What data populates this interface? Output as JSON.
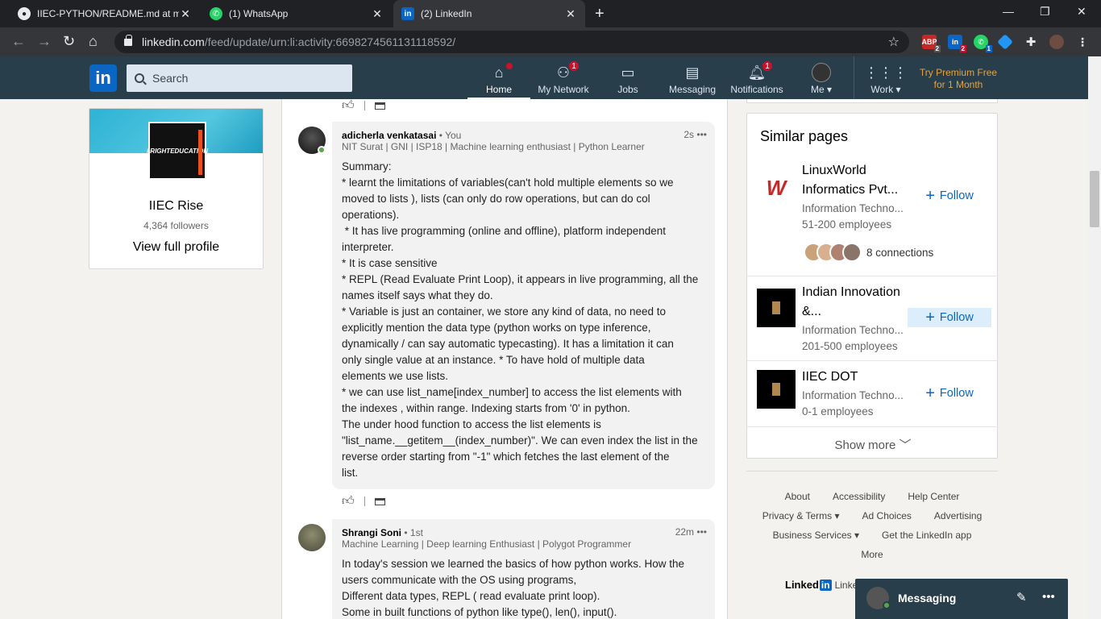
{
  "browser": {
    "tabs": [
      {
        "title": "IIEC-PYTHON/README.md at ma",
        "icon": "github-icon"
      },
      {
        "title": "(1) WhatsApp",
        "icon": "whatsapp-icon"
      },
      {
        "title": "(2) LinkedIn",
        "icon": "linkedin-icon"
      }
    ],
    "url_host": "linkedin.com",
    "url_path": "/feed/update/urn:li:activity:6698274561131118592/",
    "extensions": [
      {
        "name": "adblock-extension-icon",
        "badge": "2"
      },
      {
        "name": "linkedin-extension-icon",
        "badge": "2"
      },
      {
        "name": "whatsapp-extension-icon",
        "badge": "1"
      }
    ]
  },
  "header": {
    "logo": "in",
    "search_placeholder": "Search",
    "nav": [
      {
        "label": "Home",
        "badge": ""
      },
      {
        "label": "My Network",
        "badge": "1"
      },
      {
        "label": "Jobs",
        "badge": ""
      },
      {
        "label": "Messaging",
        "badge": ""
      },
      {
        "label": "Notifications",
        "badge": "1"
      },
      {
        "label": "Me",
        "badge": ""
      },
      {
        "label": "Work",
        "badge": ""
      }
    ],
    "premium_line1": "Try Premium Free",
    "premium_line2": "for 1 Month"
  },
  "profile": {
    "logo_text": "#RIGHTEDUCATION",
    "name": "IIEC Rise",
    "followers": "4,364 followers",
    "view_full_profile": "View full profile"
  },
  "comments": [
    {
      "name": "adicherla venkatasai",
      "degree": "• You",
      "headline": "NIT Surat | GNI | ISP18 | Machine learning enthusiast | Python Learner",
      "time": "2s",
      "text": "Summary:\n* learnt the limitations of variables(can't hold multiple elements so we\nmoved to lists ), lists (can only do row operations, but can do col\noperations).\n * It has live programming (online and offline), platform independent\ninterpreter.\n* It is case sensitive\n* REPL (Read Evaluate Print Loop), it appears in live programming, all the\nnames itself says what they do.\n* Variable is just an container, we store any kind of data, no need to\nexplicitly mention the data type (python works on type inference,\ndynamically / can say automatic typecasting). It has a limitation it can\nonly single value at an instance. * To have hold of multiple data\nelements we use lists.\n* we can use list_name[index_number] to access the list elements with\nthe indexes , within range. Indexing starts from '0' in python.\nThe under hood function to access the list elements is\n\"list_name.__getitem__(index_number)\". We can even index the list in the\nreverse order starting from \"-1\" which fetches the last element of the\nlist."
    },
    {
      "name": "Shrangi Soni",
      "degree": "• 1st",
      "headline": "Machine Learning | Deep learning Enthusiast | Polygot Programmer",
      "time": "22m",
      "text": "In today's session we learned the basics of how python works. How the\nusers communicate with the OS using programs,\nDifferent data types, REPL ( read evaluate print loop).\nSome in built functions of python like type(), len(), input()."
    }
  ],
  "similar_pages": {
    "title": "Similar pages",
    "items": [
      {
        "name_line1": "LinuxWorld",
        "name_line2": "Informatics Pvt...",
        "industry": "Information Techno...",
        "size": "51-200 employees",
        "connections": "8 connections",
        "follow": "Follow"
      },
      {
        "name_line1": "Indian Innovation",
        "name_line2": "&...",
        "industry": "Information Techno...",
        "size": "201-500 employees",
        "follow": "Follow"
      },
      {
        "name_line1": "IIEC DOT",
        "name_line2": "",
        "industry": "Information Techno...",
        "size": "0-1 employees",
        "follow": "Follow"
      }
    ],
    "show_more": "Show more"
  },
  "footer": {
    "row1": [
      "About",
      "Accessibility",
      "Help Center"
    ],
    "row2": [
      "Privacy & Terms",
      "Ad Choices",
      "Advertising"
    ],
    "row3": [
      "Business Services",
      "Get the LinkedIn app"
    ],
    "row4": [
      "More"
    ],
    "brand": "Linked",
    "brand_in": "in",
    "brand_tail": "Linke"
  },
  "messaging": {
    "label": "Messaging"
  }
}
